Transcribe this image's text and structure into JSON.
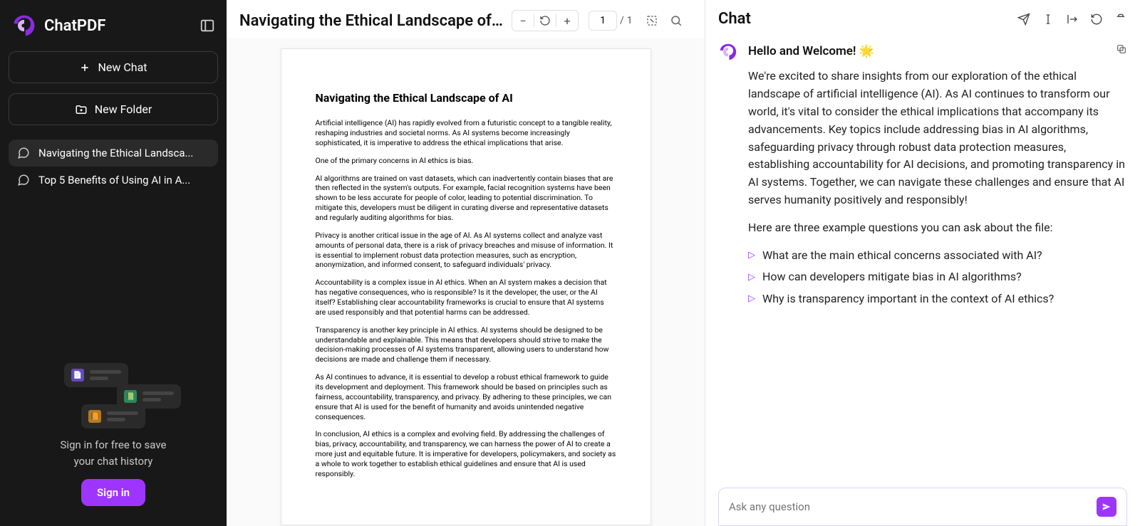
{
  "brand": {
    "name": "ChatPDF"
  },
  "sidebar": {
    "new_chat": "New Chat",
    "new_folder": "New Folder",
    "chats": [
      {
        "label": "Navigating the Ethical Landsca..."
      },
      {
        "label": "Top 5 Benefits of Using AI in A..."
      }
    ],
    "promo_line1": "Sign in for free to save",
    "promo_line2": "your chat history",
    "signin": "Sign in"
  },
  "doc": {
    "title": "Navigating the Ethical Landscape of AI....",
    "page_current": "1",
    "page_sep": "/",
    "page_total": "1",
    "page_heading": "Navigating the Ethical Landscape of AI",
    "paragraphs": [
      "Artificial intelligence (AI) has rapidly evolved from a futuristic concept to a tangible reality, reshaping industries and societal norms. As AI systems become increasingly sophisticated, it is imperative to address the ethical implications that arise.",
      "One of the primary concerns in AI ethics is bias.",
      "AI algorithms are trained on vast datasets, which can inadvertently contain biases that are then reflected in the system's outputs. For example, facial recognition systems have been shown to be less accurate for people of color, leading to potential discrimination. To mitigate this, developers must be diligent in curating diverse and representative datasets and regularly auditing algorithms for bias.",
      "Privacy is another critical issue in the age of AI. As AI systems collect and analyze vast amounts of personal data, there is a risk of privacy breaches and misuse of information. It is essential to implement robust data protection measures, such as encryption, anonymization, and informed consent, to safeguard individuals' privacy.",
      "Accountability is a complex issue in AI ethics. When an AI system makes a decision that has negative consequences, who is responsible? Is it the developer, the user, or the AI itself? Establishing clear accountability frameworks is crucial to ensure that AI systems are used responsibly and that potential harms can be addressed.",
      "Transparency is another key principle in AI ethics. AI systems should be designed to be understandable and explainable. This means that developers should strive to make the decision-making processes of AI systems transparent, allowing users to understand how decisions are made and challenge them if necessary.",
      "As AI continues to advance, it is essential to develop a robust ethical framework to guide its development and deployment. This framework should be based on principles such as fairness, accountability, transparency, and privacy. By adhering to these principles, we can ensure that AI is used for the benefit of humanity and avoids unintended negative consequences.",
      "In conclusion, AI ethics is a complex and evolving field. By addressing the challenges of bias, privacy, accountability, and transparency, we can harness the power of AI to create a more just and equitable future. It is imperative for developers, policymakers, and society as a whole to work together to establish ethical guidelines and ensure that AI is used responsibly."
    ]
  },
  "chat": {
    "title": "Chat",
    "welcome_heading": "Hello and Welcome! 🌟",
    "welcome_body": "We're excited to share insights from our exploration of the ethical landscape of artificial intelligence (AI). As AI continues to transform our world, it's vital to consider the ethical implications that accompany its advancements. Key topics include addressing bias in AI algorithms, safeguarding privacy through robust data protection measures, establishing accountability for AI decisions, and promoting transparency in AI systems. Together, we can navigate these challenges and ensure that AI serves humanity positively and responsibly!",
    "questions_intro": "Here are three example questions you can ask about the file:",
    "questions": [
      "What are the main ethical concerns associated with AI?",
      "How can developers mitigate bias in AI algorithms?",
      "Why is transparency important in the context of AI ethics?"
    ],
    "input_placeholder": "Ask any question"
  }
}
